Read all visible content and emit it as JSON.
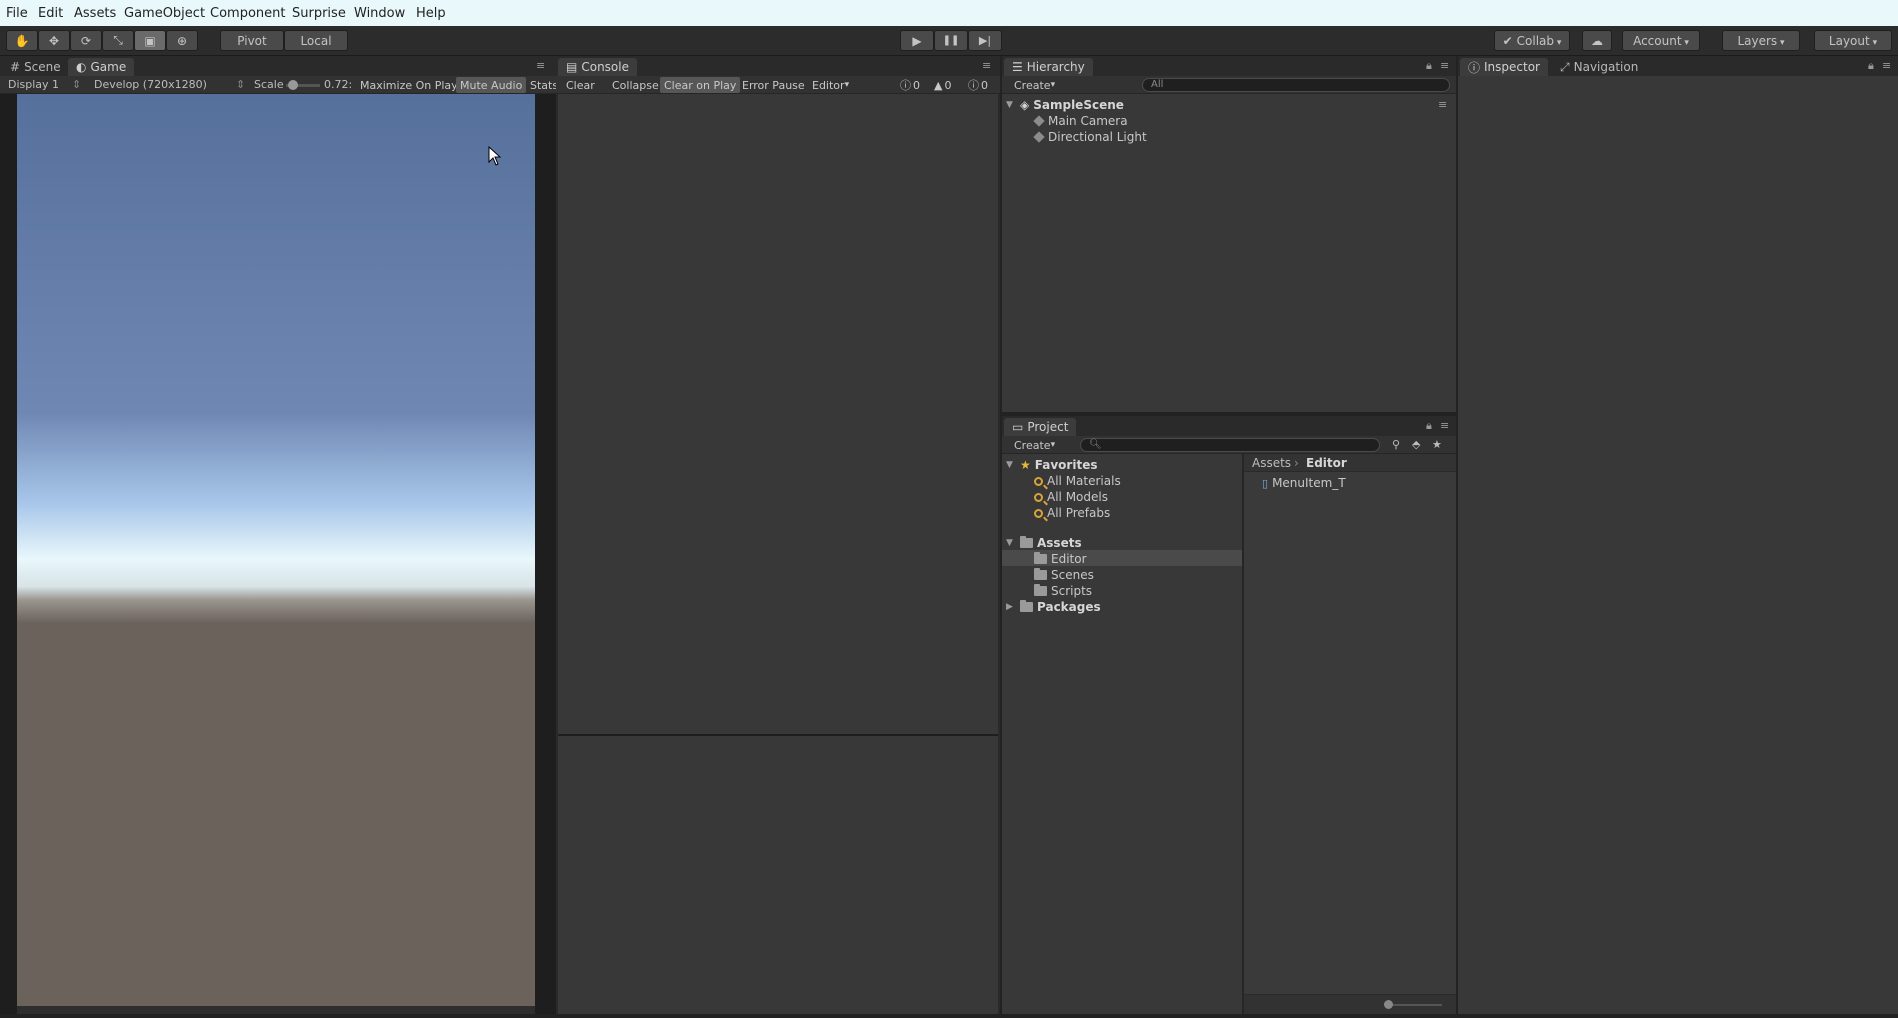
{
  "menubar": {
    "items": [
      "File",
      "Edit",
      "Assets",
      "GameObject",
      "Component",
      "Surprise",
      "Window",
      "Help"
    ]
  },
  "toolbar": {
    "tools": [
      {
        "icon": "hand-icon",
        "glyph": "✋"
      },
      {
        "icon": "move-icon",
        "glyph": "✥"
      },
      {
        "icon": "rotate-icon",
        "glyph": "⟳"
      },
      {
        "icon": "scale-icon",
        "glyph": "⤡"
      },
      {
        "icon": "rect-tool-icon",
        "glyph": "▣"
      },
      {
        "icon": "transform-tool-icon",
        "glyph": "⊕"
      }
    ],
    "pivot": "Pivot",
    "local": "Local",
    "play_glyph": "▶",
    "pause_glyph": "❚❚",
    "step_glyph": "▶|",
    "collab": "Collab",
    "account": "Account",
    "layers": "Layers",
    "layout": "Layout"
  },
  "game_panel": {
    "tabs": [
      "Scene",
      "Game"
    ],
    "display": "Display 1",
    "resolution": "Develop (720x1280)",
    "scale_label": "Scale",
    "scale_value": "0.72:",
    "scale_fraction": 0.1,
    "maximize": "Maximize On Play",
    "mute": "Mute Audio",
    "stats": "Stats",
    "sky_top": "#56709c",
    "horizon": "#e8f7fb",
    "ground": "#6b625c"
  },
  "console": {
    "tab": "Console",
    "clear": "Clear",
    "collapse": "Collapse",
    "clear_on_play": "Clear on Play",
    "error_pause": "Error Pause",
    "editor": "Editor",
    "info_count": "0",
    "warn_count": "0",
    "error_count": "0"
  },
  "hierarchy": {
    "tab": "Hierarchy",
    "create": "Create",
    "search_placeholder": "All",
    "scene": "SampleScene",
    "items": [
      "Main Camera",
      "Directional Light"
    ]
  },
  "project": {
    "tab": "Project",
    "create": "Create",
    "favorites_label": "Favorites",
    "favorites": [
      "All Materials",
      "All Models",
      "All Prefabs"
    ],
    "assets_label": "Assets",
    "asset_folders": [
      "Editor",
      "Scenes",
      "Scripts"
    ],
    "packages_label": "Packages",
    "breadcrumb_root": "Assets",
    "breadcrumb_current": "Editor",
    "files": [
      "MenuItem_T"
    ]
  },
  "inspector": {
    "tabs": [
      "Inspector",
      "Navigation"
    ]
  }
}
